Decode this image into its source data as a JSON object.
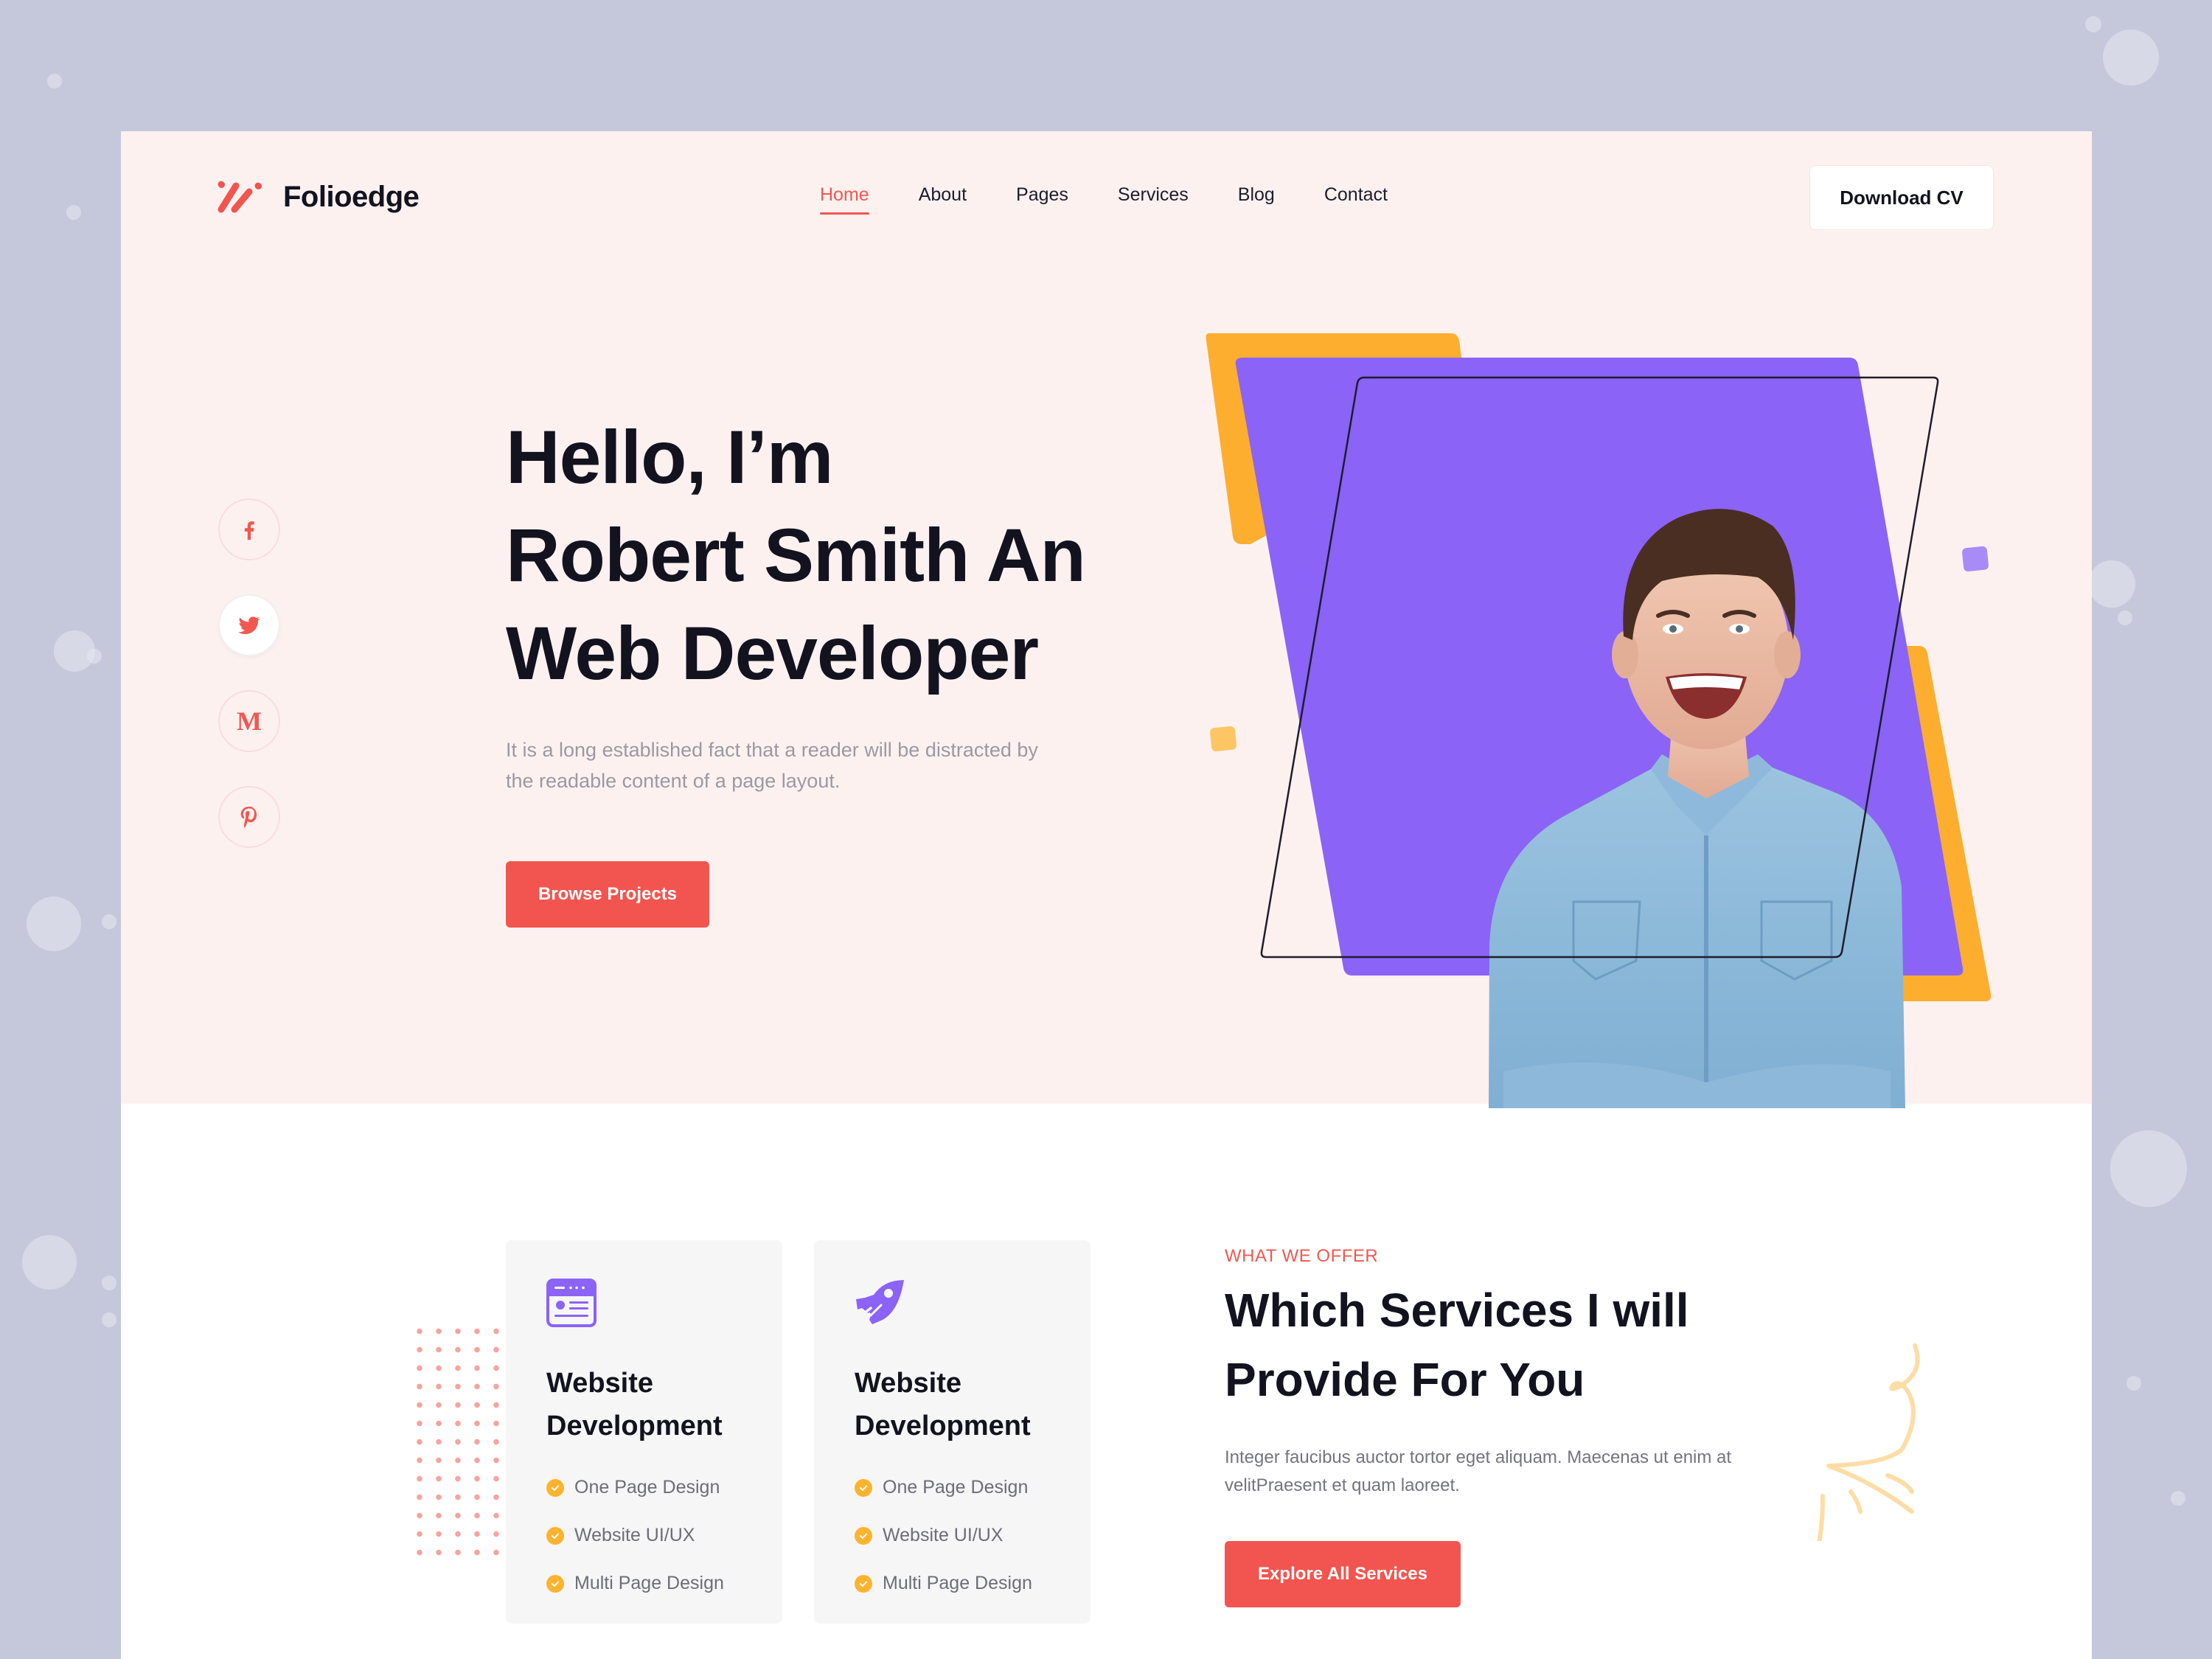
{
  "brand": {
    "name": "Folioedge",
    "logo_icon": "slash-marks-logo"
  },
  "nav": {
    "items": [
      {
        "label": "Home",
        "active": true
      },
      {
        "label": "About",
        "active": false
      },
      {
        "label": "Pages",
        "active": false
      },
      {
        "label": "Services",
        "active": false
      },
      {
        "label": "Blog",
        "active": false
      },
      {
        "label": "Contact",
        "active": false
      }
    ],
    "cta_label": "Download CV"
  },
  "social": [
    {
      "name": "facebook",
      "icon": "facebook-icon",
      "glyph": "f",
      "active": false
    },
    {
      "name": "twitter",
      "icon": "twitter-icon",
      "active": true
    },
    {
      "name": "medium",
      "icon": "medium-icon",
      "glyph": "M",
      "active": false
    },
    {
      "name": "pinterest",
      "icon": "pinterest-icon",
      "active": false
    }
  ],
  "hero": {
    "title_lines": [
      "Hello, I’m",
      "Robert Smith An",
      "Web Developer"
    ],
    "description": "It is a long established fact that a reader will be distracted by the readable content of a page layout.",
    "cta_label": "Browse Projects",
    "photo_alt": "Smiling man in denim shirt with arms crossed"
  },
  "services": {
    "eyebrow": "WHAT WE OFFER",
    "title_lines": [
      "Which Services I will",
      "Provide For You"
    ],
    "description": "Integer faucibus auctor tortor eget aliquam. Maecenas ut enim at velitPraesent et quam laoreet.",
    "cta_label": "Explore All Services",
    "cards": [
      {
        "icon": "browser-window-icon",
        "title_lines": [
          "Website",
          "Development"
        ],
        "features": [
          "One Page Design",
          "Website UI/UX",
          "Multi Page Design"
        ]
      },
      {
        "icon": "rocket-icon",
        "title_lines": [
          "Website",
          "Development"
        ],
        "features": [
          "One Page Design",
          "Website UI/UX",
          "Multi Page Design"
        ]
      }
    ]
  },
  "colors": {
    "accent": "#F2554F",
    "purple": "#8B63F7",
    "orange": "#FDAE2F",
    "hero_bg": "#FDF1F0",
    "page_bg": "#C5C8DA",
    "text_dark": "#12131F"
  }
}
